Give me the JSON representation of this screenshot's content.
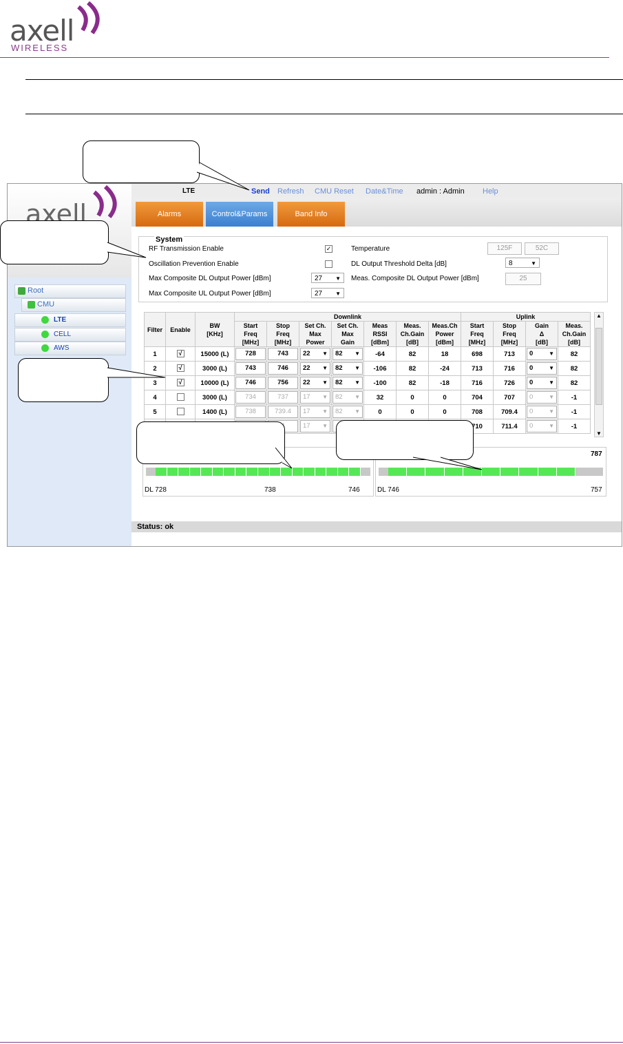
{
  "doc": {
    "logo_name": "axell",
    "logo_sub": "WIRELESS"
  },
  "app": {
    "left_logo": "axell",
    "tree": {
      "root": "Root",
      "cmu": "CMU",
      "items": [
        "LTE",
        "CELL",
        "AWS"
      ]
    },
    "topbar": {
      "title": "LTE",
      "send": "Send",
      "refresh": "Refresh",
      "cmu_reset": "CMU Reset",
      "datetime": "Date&Time",
      "user": "admin : Admin",
      "help": "Help"
    },
    "tabs": [
      "Alarms",
      "Control&Params",
      "Band Info"
    ],
    "system": {
      "title": "System",
      "rf_enable": "RF Transmission Enable",
      "osc_enable": "Oscillation Prevention Enable",
      "max_dl": "Max Composite DL Output Power [dBm]",
      "max_ul": "Max Composite UL Output Power [dBm]",
      "max_dl_value": "27",
      "max_ul_value": "27",
      "temperature": "Temperature",
      "temp_f": "125F",
      "temp_c": "52C",
      "dl_thresh": "DL Output Threshold Delta [dB]",
      "dl_thresh_value": "8",
      "meas_dl": "Meas. Composite DL Output Power [dBm]",
      "meas_dl_value": "25"
    },
    "table": {
      "group_dl": "Downlink",
      "group_ul": "Uplink",
      "headers": {
        "filter": "Filter",
        "enable": "Enable",
        "bw": [
          "BW",
          "[KHz]"
        ],
        "dl": [
          [
            "Start",
            "Freq",
            "[MHz]"
          ],
          [
            "Stop",
            "Freq",
            "[MHz]"
          ],
          [
            "Set Ch.",
            "Max",
            "Power"
          ],
          [
            "Set Ch.",
            "Max",
            "Gain"
          ],
          [
            "Meas",
            "RSSI",
            "[dBm]"
          ],
          [
            "Meas.",
            "Ch.Gain",
            "[dB]"
          ],
          [
            "Meas.Ch",
            "Power",
            "[dBm]"
          ]
        ],
        "ul": [
          [
            "Start",
            "Freq",
            "[MHz]"
          ],
          [
            "Stop",
            "Freq",
            "[MHz]"
          ],
          [
            "Gain",
            "Δ",
            "[dB]"
          ],
          [
            "Meas.",
            "Ch.Gain",
            "[dB]"
          ]
        ]
      },
      "rows": [
        {
          "filter": "1",
          "enabled": "√",
          "bw": "15000 (L)",
          "dl_start": "728",
          "dl_stop": "743",
          "power": "22",
          "gain": "82",
          "rssi": "-64",
          "ch_gain": "82",
          "ch_power": "18",
          "ul_start": "698",
          "ul_stop": "713",
          "gain_delta": "0",
          "ul_ch_gain": "82",
          "active": true
        },
        {
          "filter": "2",
          "enabled": "√",
          "bw": "3000 (L)",
          "dl_start": "743",
          "dl_stop": "746",
          "power": "22",
          "gain": "82",
          "rssi": "-106",
          "ch_gain": "82",
          "ch_power": "-24",
          "ul_start": "713",
          "ul_stop": "716",
          "gain_delta": "0",
          "ul_ch_gain": "82",
          "active": true
        },
        {
          "filter": "3",
          "enabled": "√",
          "bw": "10000 (L)",
          "dl_start": "746",
          "dl_stop": "756",
          "power": "22",
          "gain": "82",
          "rssi": "-100",
          "ch_gain": "82",
          "ch_power": "-18",
          "ul_start": "716",
          "ul_stop": "726",
          "gain_delta": "0",
          "ul_ch_gain": "82",
          "active": true
        },
        {
          "filter": "4",
          "enabled": "",
          "bw": "3000 (L)",
          "dl_start": "734",
          "dl_stop": "737",
          "power": "17",
          "gain": "82",
          "rssi": "32",
          "ch_gain": "0",
          "ch_power": "0",
          "ul_start": "704",
          "ul_stop": "707",
          "gain_delta": "0",
          "ul_ch_gain": "-1",
          "active": false
        },
        {
          "filter": "5",
          "enabled": "",
          "bw": "1400 (L)",
          "dl_start": "738",
          "dl_stop": "739.4",
          "power": "17",
          "gain": "82",
          "rssi": "0",
          "ch_gain": "0",
          "ch_power": "0",
          "ul_start": "708",
          "ul_stop": "709.4",
          "gain_delta": "0",
          "ul_ch_gain": "-1",
          "active": false
        },
        {
          "filter": "",
          "enabled": "",
          "bw": "",
          "dl_start": "",
          "dl_stop": "4",
          "power": "17",
          "gain": "",
          "rssi": "",
          "ch_gain": "",
          "ch_power": "",
          "ul_start": "710",
          "ul_stop": "711.4",
          "gain_delta": "0",
          "ul_ch_gain": "-1",
          "active": false
        }
      ]
    },
    "spectrum": {
      "left": {
        "start": "DL 728",
        "mid": "738",
        "end": "746"
      },
      "right": {
        "start": "DL 746",
        "end": "757",
        "top": "787"
      }
    },
    "status": "Status: ok"
  }
}
